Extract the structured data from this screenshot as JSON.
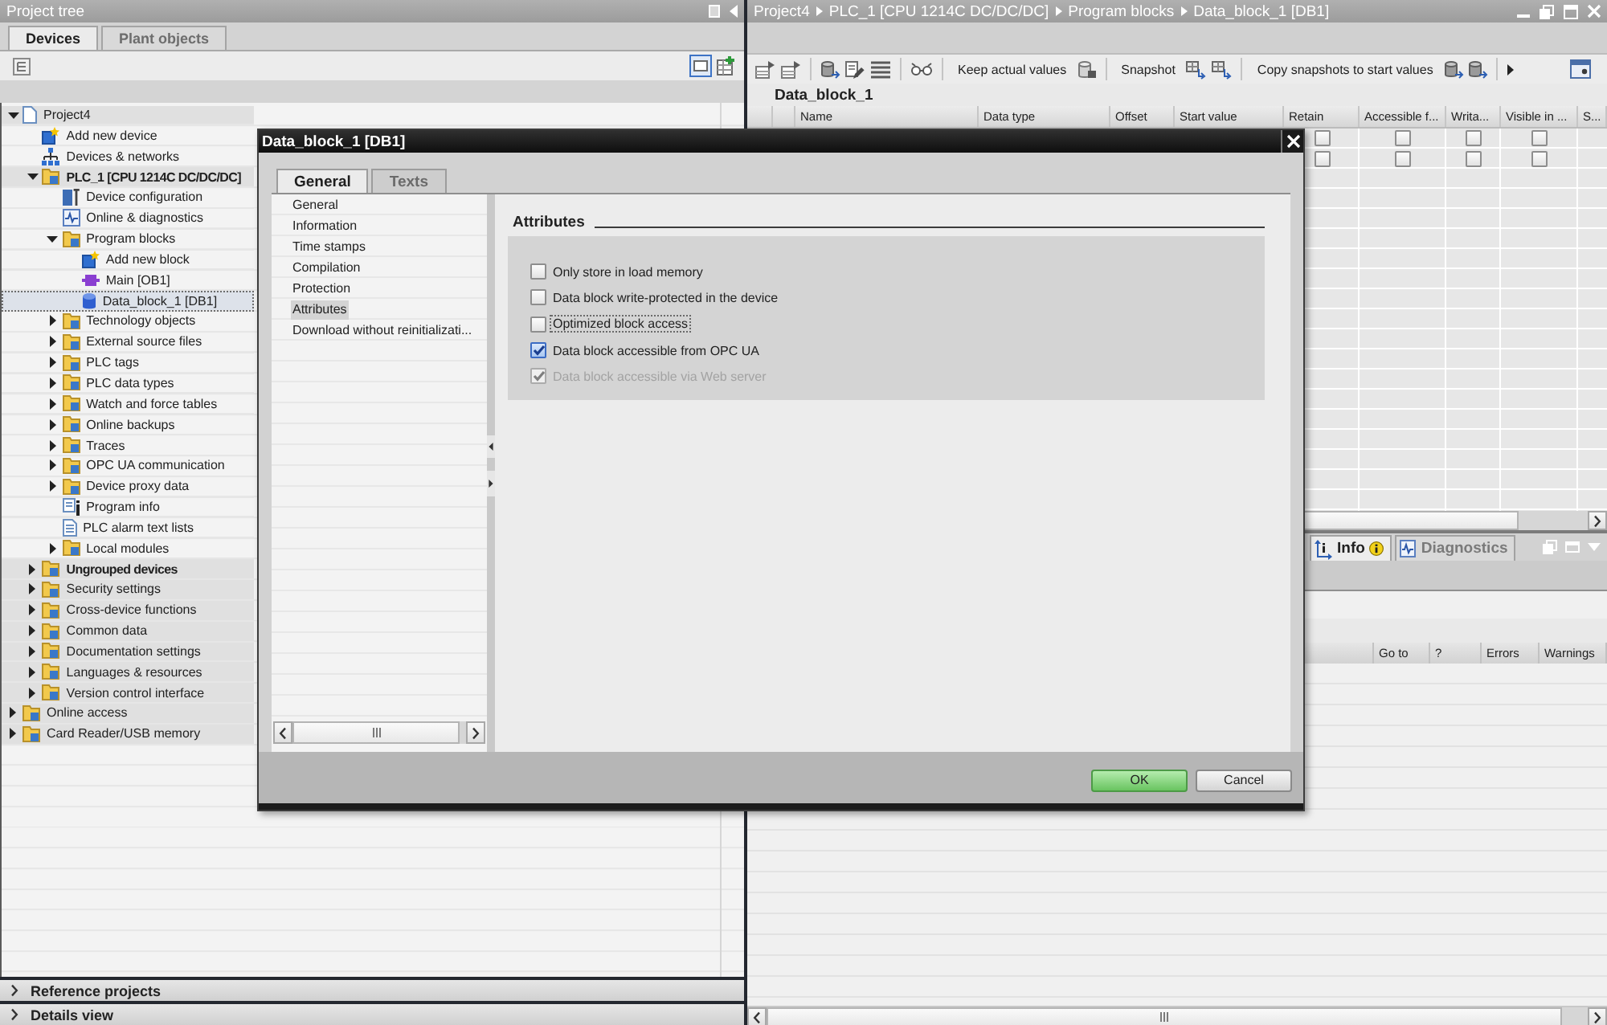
{
  "project_tree": {
    "title": "Project tree",
    "tabs": [
      {
        "label": "Devices",
        "selected": true
      },
      {
        "label": "Plant objects",
        "selected": false
      }
    ],
    "items": [
      {
        "label": "Project4",
        "kind": "group",
        "expanded": true,
        "selected": false,
        "children": [
          {
            "label": "Add new device",
            "kind": "item",
            "selected": false
          },
          {
            "label": "Devices & networks",
            "kind": "item",
            "selected": false
          },
          {
            "label": "PLC_1 [CPU 1214C DC/DC/DC]",
            "kind": "device",
            "expanded": true,
            "selected": false,
            "children": [
              {
                "label": "Device configuration",
                "kind": "item",
                "selected": false
              },
              {
                "label": "Online & diagnostics",
                "kind": "item",
                "selected": false
              },
              {
                "label": "Program blocks",
                "kind": "item",
                "expanded": true,
                "selected": false,
                "children": [
                  {
                    "label": "Add new block",
                    "kind": "item",
                    "selected": false
                  },
                  {
                    "label": "Main [OB1]",
                    "kind": "item",
                    "selected": false
                  },
                  {
                    "label": "Data_block_1 [DB1]",
                    "kind": "item",
                    "selected": true
                  }
                ]
              },
              {
                "label": "Technology objects",
                "kind": "item",
                "expanded": false,
                "selected": false
              },
              {
                "label": "External source files",
                "kind": "item",
                "expanded": false,
                "selected": false
              },
              {
                "label": "PLC tags",
                "kind": "item",
                "expanded": false,
                "selected": false
              },
              {
                "label": "PLC data types",
                "kind": "item",
                "expanded": false,
                "selected": false
              },
              {
                "label": "Watch and force tables",
                "kind": "item",
                "expanded": false,
                "selected": false
              },
              {
                "label": "Online backups",
                "kind": "item",
                "expanded": false,
                "selected": false
              },
              {
                "label": "Traces",
                "kind": "item",
                "expanded": false,
                "selected": false
              },
              {
                "label": "OPC UA communication",
                "kind": "item",
                "expanded": false,
                "selected": false
              },
              {
                "label": "Device proxy data",
                "kind": "item",
                "expanded": false,
                "selected": false
              },
              {
                "label": "Program info",
                "kind": "item",
                "selected": false
              },
              {
                "label": "PLC alarm text lists",
                "kind": "item",
                "selected": false
              },
              {
                "label": "Local modules",
                "kind": "item",
                "expanded": false,
                "selected": false
              }
            ]
          },
          {
            "label": "Ungrouped devices",
            "kind": "device",
            "expanded": false,
            "selected": false
          },
          {
            "label": "Security settings",
            "kind": "group",
            "expanded": false,
            "selected": false
          },
          {
            "label": "Cross-device functions",
            "kind": "group",
            "expanded": false,
            "selected": false
          },
          {
            "label": "Common data",
            "kind": "group",
            "expanded": false,
            "selected": false
          },
          {
            "label": "Documentation settings",
            "kind": "group",
            "expanded": false,
            "selected": false
          },
          {
            "label": "Languages & resources",
            "kind": "group",
            "expanded": false,
            "selected": false
          },
          {
            "label": "Version control interface",
            "kind": "group",
            "expanded": false,
            "selected": false
          }
        ]
      },
      {
        "label": "Online access",
        "kind": "group",
        "expanded": false,
        "selected": false
      },
      {
        "label": "Card Reader/USB memory",
        "kind": "group",
        "expanded": false,
        "selected": false
      }
    ]
  },
  "bottom_bars": [
    {
      "label": "Reference projects",
      "expanded": false
    },
    {
      "label": "Details view",
      "expanded": false
    }
  ],
  "editor": {
    "breadcrumb": [
      "Project4",
      "PLC_1 [CPU 1214C DC/DC/DC]",
      "Program blocks",
      "Data_block_1 [DB1]"
    ],
    "toolbar_buttons": [
      "Keep actual values",
      "Snapshot",
      "Copy snapshots to start values"
    ],
    "block_title": "Data_block_1",
    "table": {
      "columns": [
        "Name",
        "Data type",
        "Offset",
        "Start value",
        "Retain",
        "Accessible f...",
        "Writa...",
        "Visible in ...",
        "S..."
      ],
      "rows": [
        {
          "checks": [
            {
              "checked": false
            },
            {
              "checked": false
            },
            {
              "checked": false
            },
            {
              "checked": false
            }
          ]
        },
        {
          "checks": [
            {
              "checked": false
            },
            {
              "checked": false
            },
            {
              "checked": false
            },
            {
              "checked": false
            }
          ]
        }
      ]
    }
  },
  "inspector": {
    "tabs": [
      {
        "label": "Info",
        "selected": true
      },
      {
        "label": "Diagnostics",
        "selected": false
      }
    ],
    "columns": [
      "Go to",
      "?",
      "Errors",
      "Warnings"
    ]
  },
  "dialog": {
    "title": "Data_block_1 [DB1]",
    "tabs": [
      {
        "label": "General",
        "selected": true
      },
      {
        "label": "Texts",
        "selected": false
      }
    ],
    "nav": [
      {
        "label": "General",
        "selected": false
      },
      {
        "label": "Information",
        "selected": false
      },
      {
        "label": "Time stamps",
        "selected": false
      },
      {
        "label": "Compilation",
        "selected": false
      },
      {
        "label": "Protection",
        "selected": false
      },
      {
        "label": "Attributes",
        "selected": true
      },
      {
        "label": "Download without reinitializati...",
        "selected": false
      }
    ],
    "section_title": "Attributes",
    "options": [
      {
        "label": "Only store in load memory",
        "checked": false,
        "disabled": false,
        "focused": false
      },
      {
        "label": "Data block write-protected in the device",
        "checked": false,
        "disabled": false,
        "focused": false
      },
      {
        "label": "Optimized block access",
        "checked": false,
        "disabled": false,
        "focused": true
      },
      {
        "label": "Data block accessible from OPC UA",
        "checked": true,
        "disabled": false,
        "focused": false
      },
      {
        "label": "Data block accessible via Web server",
        "checked": true,
        "disabled": true,
        "focused": false
      }
    ],
    "buttons": [
      {
        "label": "OK",
        "kind": "primary"
      },
      {
        "label": "Cancel",
        "kind": "secondary"
      }
    ]
  }
}
